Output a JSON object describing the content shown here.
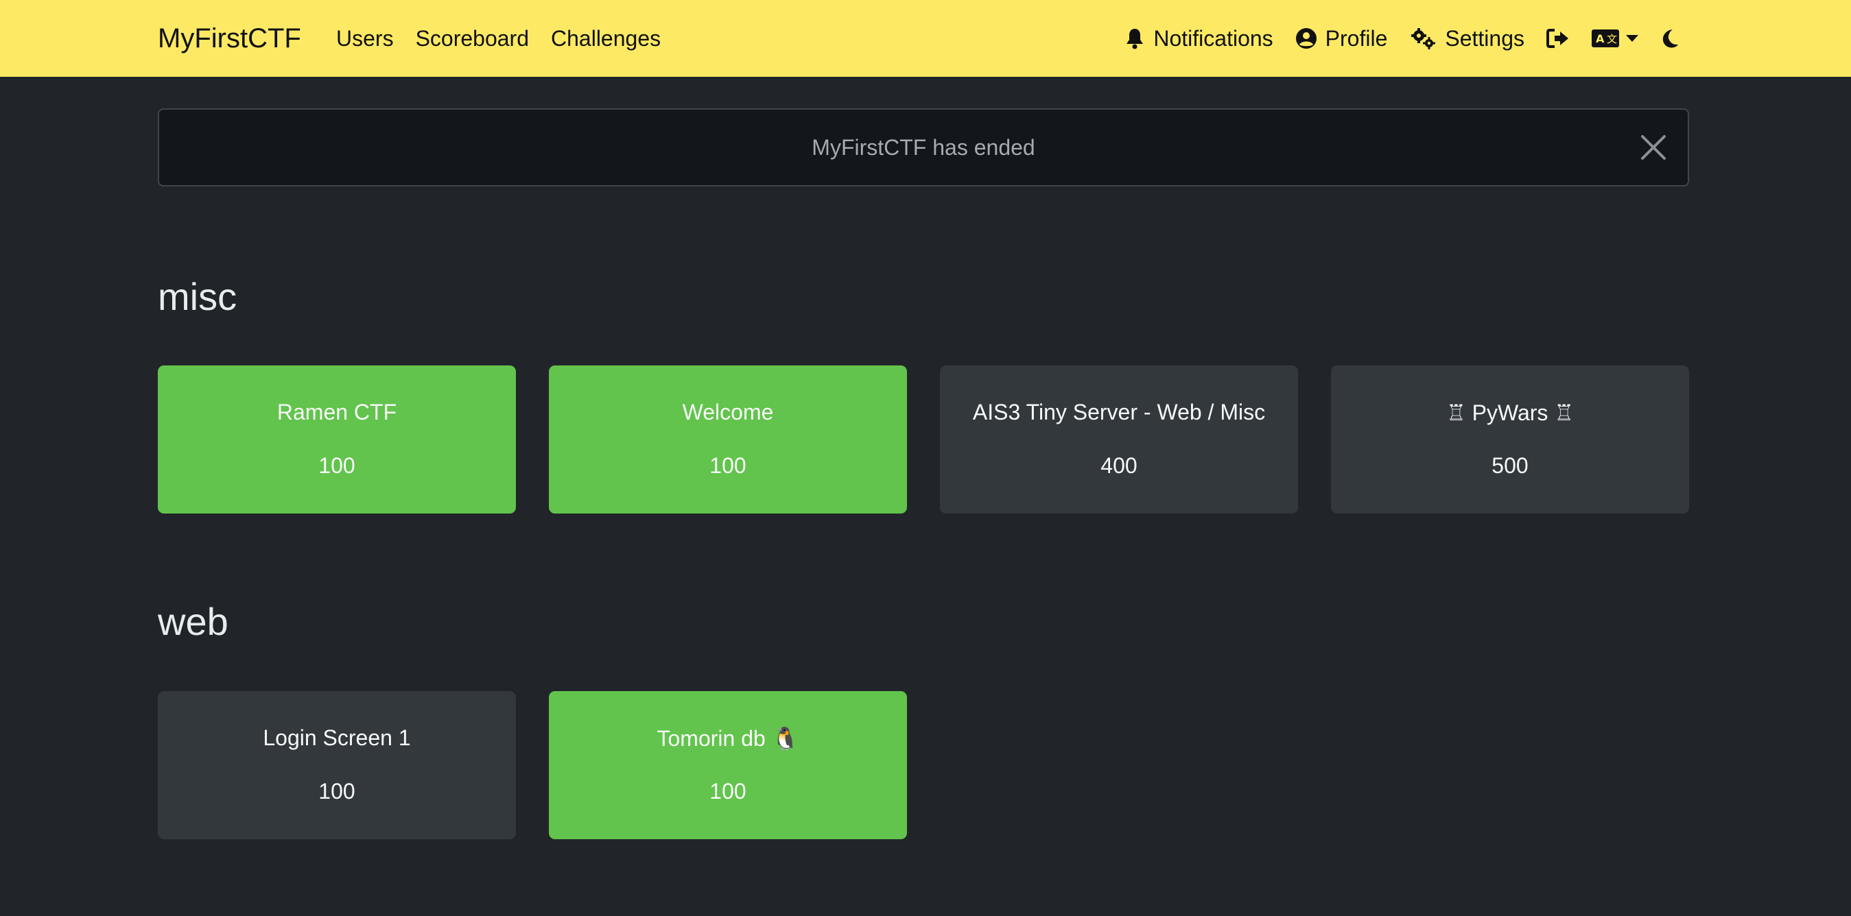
{
  "navbar": {
    "brand": "MyFirstCTF",
    "links": [
      "Users",
      "Scoreboard",
      "Challenges"
    ],
    "notifications_label": "Notifications",
    "profile_label": "Profile",
    "settings_label": "Settings",
    "icons": {
      "notifications": "bell-icon",
      "profile": "user-circle-icon",
      "settings": "gears-icon",
      "logout": "sign-out-icon",
      "language": "language-icon",
      "language_caret": "caret-down-icon",
      "theme": "moon-icon"
    },
    "background_color": "#fde964"
  },
  "alert": {
    "message": "MyFirstCTF has ended"
  },
  "categories": [
    {
      "name": "misc",
      "challenges": [
        {
          "name": "Ramen CTF",
          "value": "100",
          "solved": true
        },
        {
          "name": "Welcome",
          "value": "100",
          "solved": true
        },
        {
          "name": "AIS3 Tiny Server - Web / Misc",
          "value": "400",
          "solved": false
        },
        {
          "name": "♖ PyWars ♖",
          "value": "500",
          "solved": false
        }
      ]
    },
    {
      "name": "web",
      "challenges": [
        {
          "name": "Login Screen 1",
          "value": "100",
          "solved": false
        },
        {
          "name": "Tomorin db 🐧",
          "value": "100",
          "solved": true
        }
      ]
    }
  ],
  "colors": {
    "solved": "#62c44c",
    "unsolved": "#33383d",
    "page_background": "#212529"
  }
}
